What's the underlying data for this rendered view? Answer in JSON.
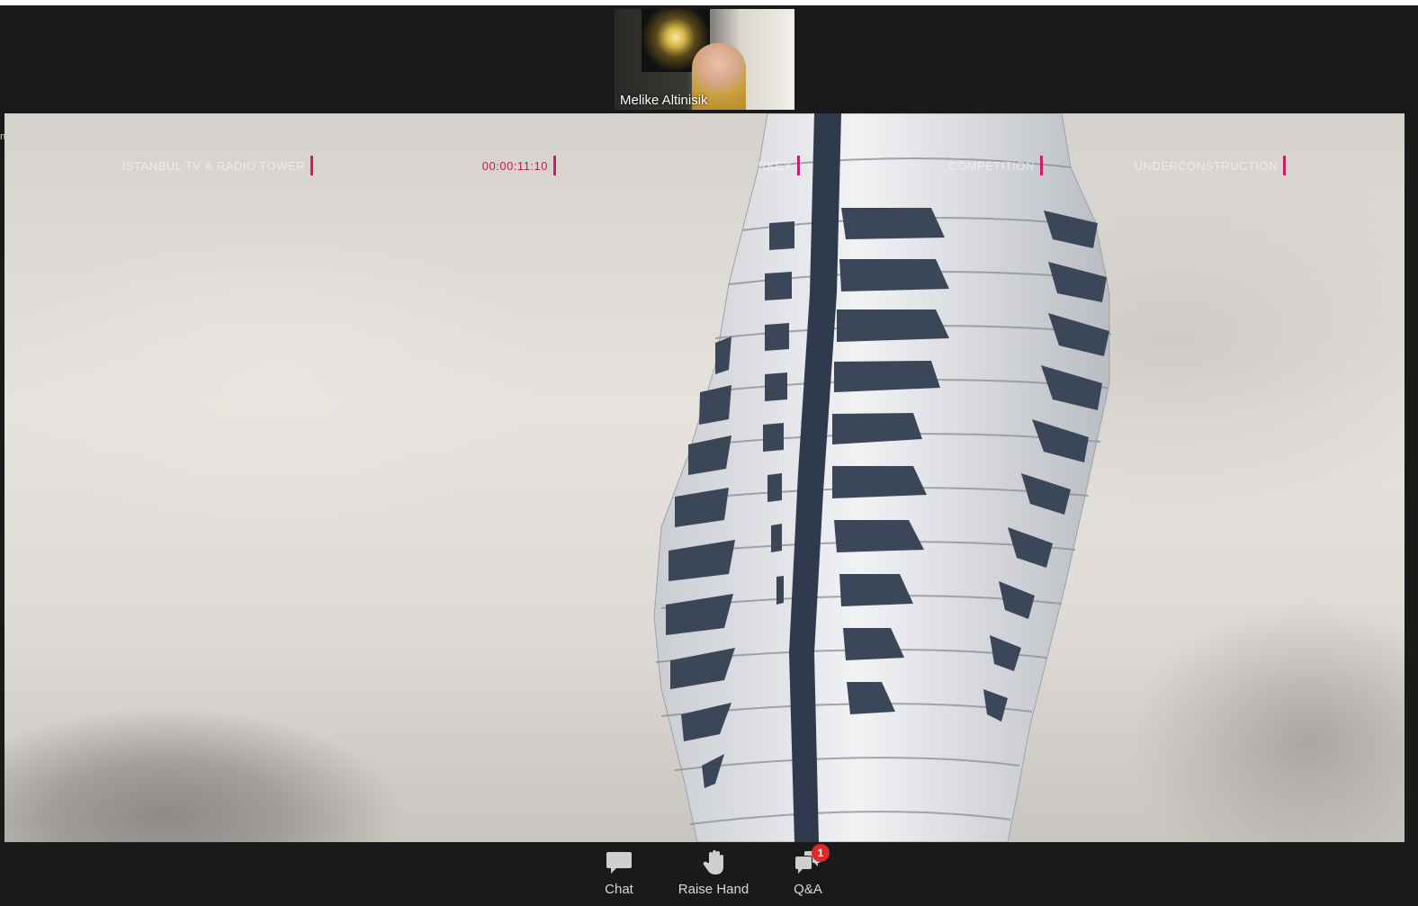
{
  "participant": {
    "name": "Melike Altinisik"
  },
  "shared_screen": {
    "edge_text": "ng",
    "overlay": {
      "project": "ISTANBUL TV & RADIO TOWER",
      "timecode": "00:00:11:10",
      "location": "RKEY",
      "type": "COMPETITION",
      "status": "UNDERCONSTRUCTION"
    }
  },
  "toolbar": {
    "chat": {
      "label": "Chat",
      "icon": "chat-bubble-icon"
    },
    "raise_hand": {
      "label": "Raise Hand",
      "icon": "hand-icon"
    },
    "qa": {
      "label": "Q&A",
      "icon": "qa-bubbles-icon",
      "badge": "1"
    }
  },
  "colors": {
    "background": "#1a1a1a",
    "overlay_accent": "#d11a6b",
    "badge": "#e02828"
  }
}
